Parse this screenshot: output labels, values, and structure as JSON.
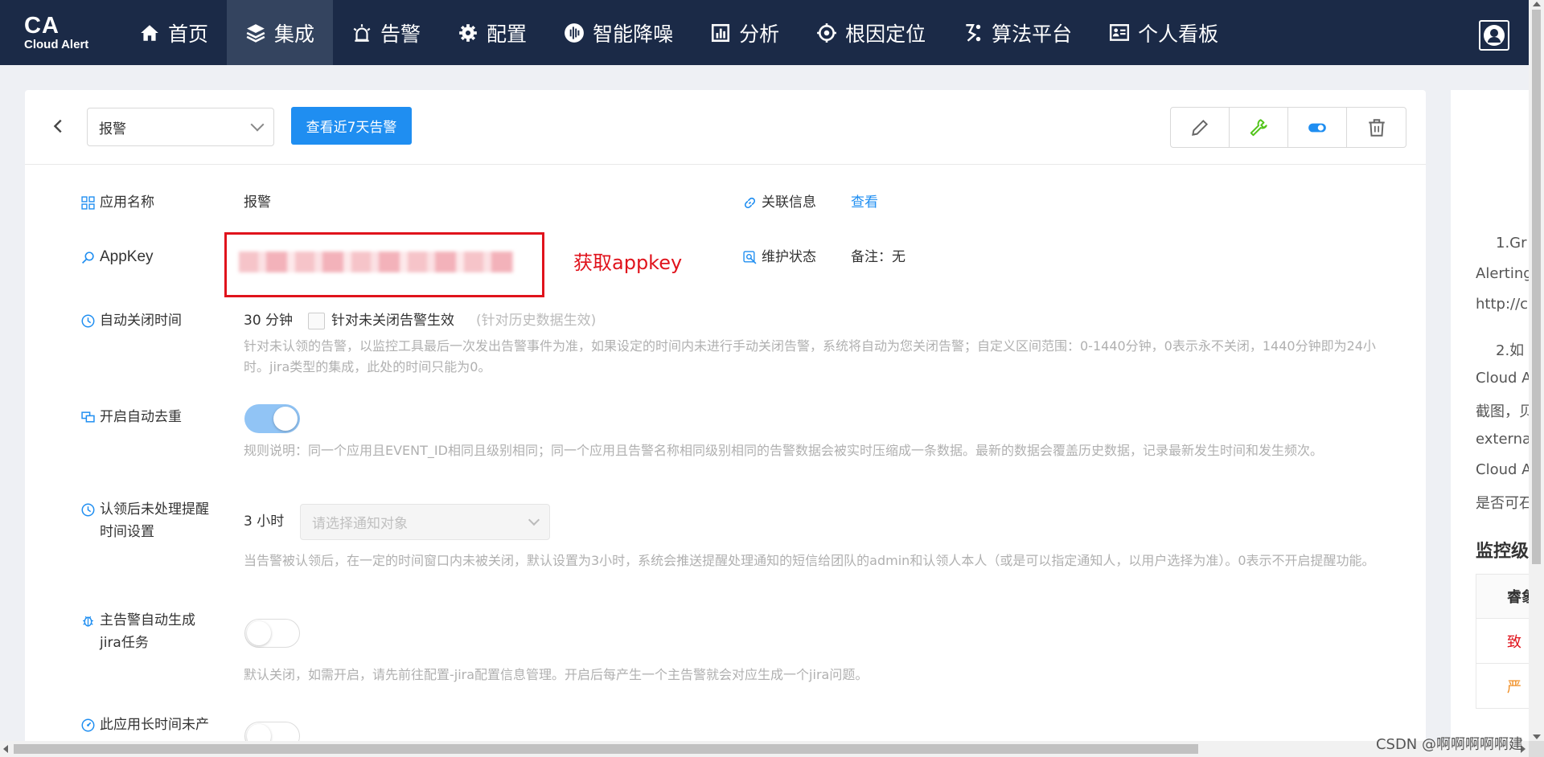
{
  "logo": {
    "title": "CA",
    "subtitle": "Cloud Alert"
  },
  "nav": [
    {
      "label": "首页",
      "icon": "home-icon"
    },
    {
      "label": "集成",
      "icon": "layers-icon",
      "active": true
    },
    {
      "label": "告警",
      "icon": "alarm-light-icon"
    },
    {
      "label": "配置",
      "icon": "gear-icon"
    },
    {
      "label": "智能降噪",
      "icon": "waveform-icon"
    },
    {
      "label": "分析",
      "icon": "bar-chart-icon"
    },
    {
      "label": "根因定位",
      "icon": "target-icon"
    },
    {
      "label": "算法平台",
      "icon": "algorithm-icon"
    },
    {
      "label": "个人看板",
      "icon": "dashboard-icon"
    }
  ],
  "toolbar": {
    "select_value": "报警",
    "view_button": "查看近7天告警",
    "tools": [
      "edit-icon",
      "wrench-icon",
      "toggle-icon",
      "trash-icon"
    ]
  },
  "form": {
    "app_name": {
      "label": "应用名称",
      "value": "报警"
    },
    "related": {
      "label": "关联信息",
      "link": "查看"
    },
    "appkey": {
      "label": "AppKey",
      "annotation": "获取appkey"
    },
    "maintenance": {
      "label": "维护状态",
      "value": "备注：无"
    },
    "auto_close": {
      "label": "自动关闭时间",
      "value": "30 分钟",
      "checkbox_label": "针对未关闭告警生效",
      "checkbox_hint": "(针对历史数据生效)",
      "help": "针对未认领的告警，以监控工具最后一次发出告警事件为准，如果设定的时间内未进行手动关闭告警，系统将自动为您关闭告警；自定义区间范围：0-1440分钟，0表示永不关闭，1440分钟即为24小时。jira类型的集成，此处的时间只能为0。"
    },
    "dedupe": {
      "label": "开启自动去重",
      "enabled": true,
      "help": "规则说明：同一个应用且EVENT_ID相同且级别相同；同一个应用且告警名称相同级别相同的告警数据会被实时压缩成一条数据。最新的数据会覆盖历史数据，记录最新发生时间和发生频次。"
    },
    "reminder": {
      "label_line1": "认领后未处理提醒",
      "label_line2": "时间设置",
      "value": "3 小时",
      "placeholder": "请选择通知对象",
      "help": "当告警被认领后，在一定的时间窗口内未被关闭，默认设置为3小时，系统会推送提醒处理通知的短信给团队的admin和认领人本人（或是可以指定通知人，以用户选择为准）。0表示不开启提醒功能。"
    },
    "jira": {
      "label_line1": "主告警自动生成",
      "label_line2": "jira任务",
      "enabled": false,
      "help": "默认关闭，如需开启，请先前往配置-jira配置信息管理。开启后每产生一个主告警就会对应生成一个jira问题。"
    },
    "inactive": {
      "label": "此应用长时间未产",
      "enabled": false
    }
  },
  "right_panel": {
    "lines": [
      "1.Gr",
      "Alerting",
      "http://c",
      "2.如",
      "Cloud A",
      "截图，贝",
      "externa",
      "Cloud A",
      "是否可石"
    ],
    "title": "监控级",
    "table_head": "睿象",
    "rows": [
      {
        "text": "致",
        "color": "#e0131c"
      },
      {
        "text": "严",
        "color": "#f08c1f"
      }
    ]
  },
  "watermark": "CSDN @啊啊啊啊啊建"
}
